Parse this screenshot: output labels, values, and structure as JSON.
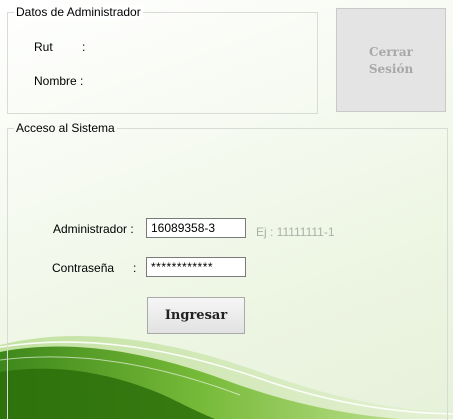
{
  "admin_panel": {
    "title": "Datos de Administrador",
    "rut_label": "Rut",
    "rut_colon": ":",
    "nombre_label": "Nombre :"
  },
  "logout": {
    "label_line1": "Cerrar",
    "label_line2": "Sesión"
  },
  "access_panel": {
    "title": "Acceso al Sistema",
    "admin_label": "Administrador :",
    "admin_value": "16089358-3",
    "hint": "Ej : 11111111-1",
    "password_label": "Contraseña",
    "password_colon": ":",
    "password_value": "************",
    "login_label": "Ingresar"
  },
  "colors": {
    "logout_bg": "#e4e4e4",
    "logout_text": "#a8a8a8",
    "swoosh": "#4e9a1a"
  }
}
